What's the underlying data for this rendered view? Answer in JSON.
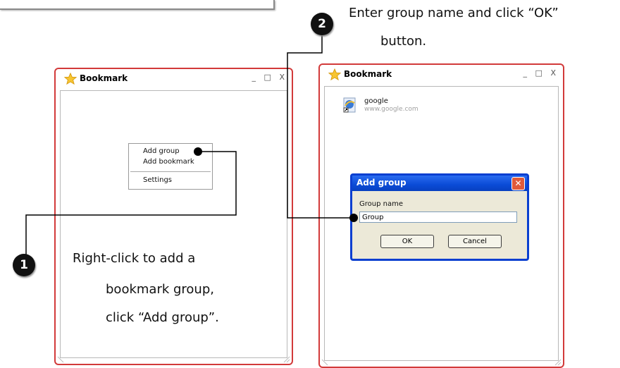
{
  "left_window": {
    "title": "Bookmark",
    "window_controls": [
      "_",
      "□",
      "X"
    ],
    "context_menu": {
      "items": [
        "Add group",
        "Add bookmark",
        "Settings"
      ]
    }
  },
  "right_window": {
    "title": "Bookmark",
    "window_controls": [
      "_",
      "□",
      "X"
    ],
    "bookmark": {
      "title": "google",
      "url": "www.google.com"
    },
    "dialog": {
      "title": "Add group",
      "close_glyph": "✕",
      "field_label": "Group name",
      "field_value": "Group",
      "ok_label": "OK",
      "cancel_label": "Cancel"
    }
  },
  "annotations": {
    "step1_number": "1",
    "step1_lines": [
      "Right-click to add a",
      "bookmark group,",
      "click “Add group”."
    ],
    "step2_number": "2",
    "step2_lines": [
      "Enter group name and click “OK”",
      "button."
    ]
  },
  "colors": {
    "window_border": "#d23a3a",
    "dialog_title": "#0a4bd6",
    "badge": "#111111"
  }
}
